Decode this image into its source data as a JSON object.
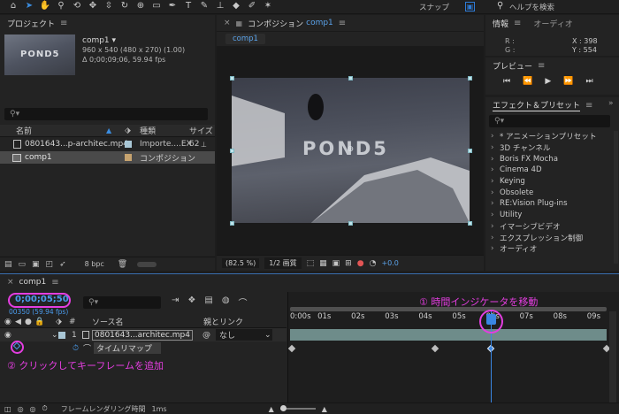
{
  "toolbar": {
    "snap_label": "スナップ",
    "help_search": "ヘルプを検索",
    "icons": [
      "home-icon",
      "selection-tool-icon",
      "hand-tool-icon",
      "zoom-tool-icon",
      "orbit-camera-icon",
      "pan-camera-icon",
      "dolly-camera-icon",
      "rotate-tool-icon",
      "anchor-tool-icon",
      "rectangle-tool-icon",
      "pen-tool-icon",
      "type-tool-icon",
      "brush-tool-icon",
      "stamp-tool-icon",
      "eraser-tool-icon",
      "roto-brush-icon",
      "puppet-tool-icon"
    ]
  },
  "project": {
    "title": "プロジェクト",
    "comp_name": "comp1 ▾",
    "comp_info1": "960 x 540  (480 x 270) (1.00)",
    "comp_info2": "Δ 0;00;09;06, 59.94 fps",
    "thumb_watermark": "POND5",
    "search_placeholder": "⚲▾",
    "col_name": "名前",
    "col_type": "種類",
    "col_size": "サイズ",
    "items": [
      {
        "name": "0801643...p-architec.mp4",
        "type": "Importe....EX",
        "size": "62"
      },
      {
        "name": "comp1",
        "type": "コンポジション",
        "size": ""
      }
    ],
    "bpc": "8 bpc"
  },
  "composition": {
    "tab_title": "コンポジション",
    "tab_comp": "comp1",
    "subtab": "comp1",
    "watermark": "POND5",
    "zoom": "(82.5 %)",
    "quality": "1/2 画質",
    "exposure": "+0.0"
  },
  "info": {
    "title": "情報",
    "audio_tab": "オーディオ",
    "r_label": "R :",
    "g_label": "G :",
    "x_readout": "X : 398",
    "y_readout": "Y : 554"
  },
  "preview": {
    "title": "プレビュー"
  },
  "effects": {
    "title": "エフェクト＆プリセット",
    "search_placeholder": "⚲▾",
    "items": [
      "* アニメーションプリセット",
      "3D チャンネル",
      "Boris FX Mocha",
      "Cinema 4D",
      "Keying",
      "Obsolete",
      "RE:Vision Plug-ins",
      "Utility",
      "イマーシブビデオ",
      "エクスプレッション制御",
      "オーディオ"
    ]
  },
  "timeline": {
    "tab": "comp1",
    "timecode": "0;00;05;50",
    "frame_info": "00350 (59.94 fps)",
    "search_placeholder": "⚲▾",
    "col_source": "ソース名",
    "col_parent": "親とリンク",
    "layer_num": "1",
    "layer_name": "0801643...architec.mp4",
    "parent_value": "なし",
    "property": "タイムリマップ",
    "ruler_ticks": [
      "0:00s",
      "01s",
      "02s",
      "03s",
      "04s",
      "05s",
      "06s",
      "07s",
      "08s",
      "09s"
    ],
    "render_label": "フレームレンダリング時間",
    "render_value": "1ms"
  },
  "annotations": {
    "step1": "① 時間インジケータを移動",
    "step2": "② クリックしてキーフレームを追加"
  },
  "colors": {
    "accent": "#2e7bd6",
    "annotation": "#e43ee0",
    "layer_bar": "#6e8c8a"
  }
}
